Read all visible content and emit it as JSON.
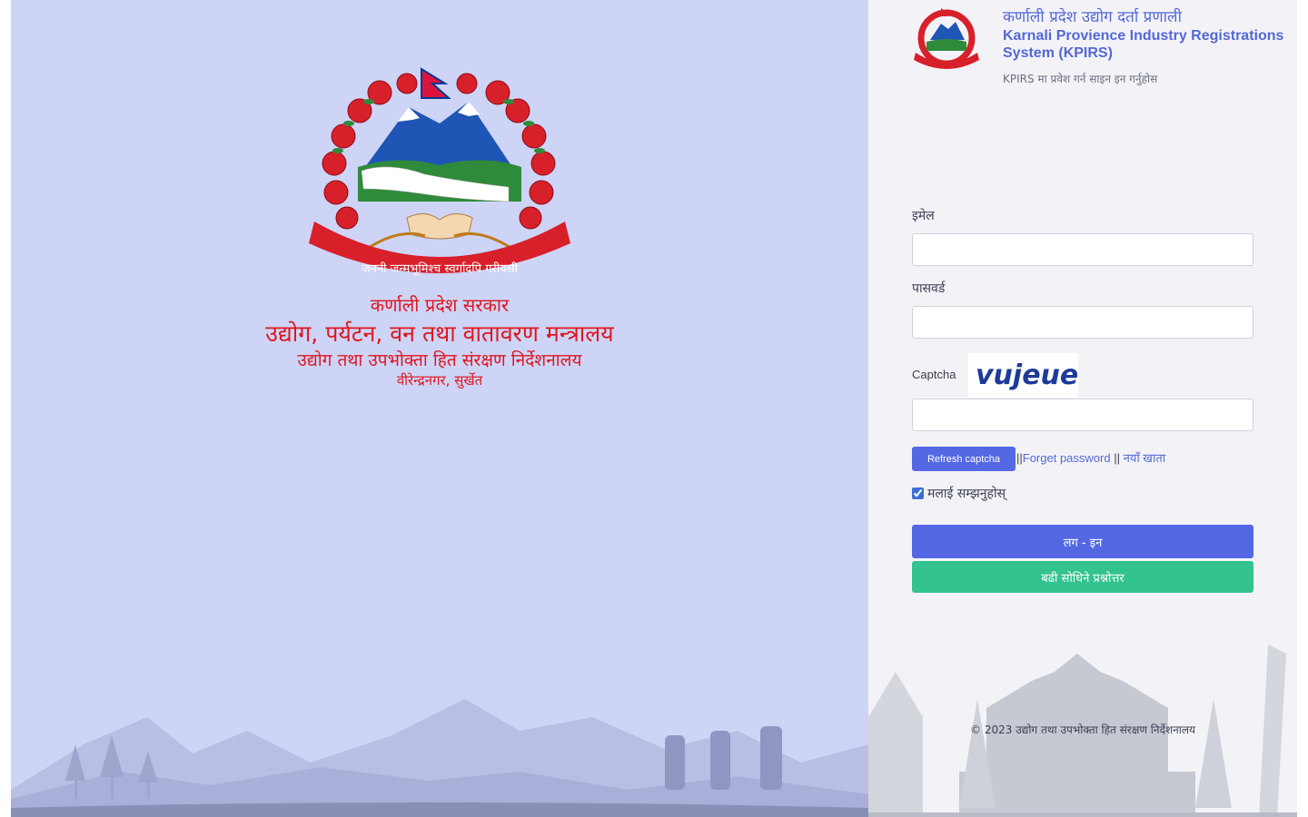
{
  "gov": {
    "line1": "कर्णाली प्रदेश सरकार",
    "line2": "उद्योग, पर्यटन, वन तथा वातावरण मन्त्रालय",
    "line3": "उद्योग तथा उपभोक्ता हित संरक्षण निर्देशनालय",
    "line4": "वीरेन्द्रनगर, सुर्खेत",
    "emblem_motto": "जननी जन्मभूमिश्च स्वर्गादपि गरीयसी"
  },
  "header": {
    "title_np": "कर्णाली प्रदेश उद्योग दर्ता प्रणाली",
    "title_en": "Karnali Provience Industry Registrations System (KPIRS)",
    "subtitle": "KPIRS मा प्रवेश गर्न साइन इन गर्नुहोस"
  },
  "form": {
    "email_label": "इमेल",
    "email_value": "",
    "password_label": "पासवर्ड",
    "password_value": "",
    "captcha_label": "Captcha",
    "captcha_text": "vujeue",
    "captcha_value": "",
    "refresh_label": "Refresh captcha",
    "sep1": "||",
    "forget_label": "Forget password",
    "sep2": " || ",
    "new_account_label": "नयाँ खाता",
    "remember_label": "मलाई सम्झनुहोस्",
    "remember_checked": true,
    "login_label": "लग - इन",
    "faq_label": "बढी सोधिने प्रश्नोत्तर"
  },
  "footer": {
    "text": "© 2023 उद्योग तथा उपभोक्ता हित संरक्षण निर्देशनालय"
  },
  "colors": {
    "left_bg": "#ced4f6",
    "primary": "#5468e4",
    "success": "#34c38f",
    "gov_red": "#e0161f",
    "heading_blue": "#5468d6"
  }
}
